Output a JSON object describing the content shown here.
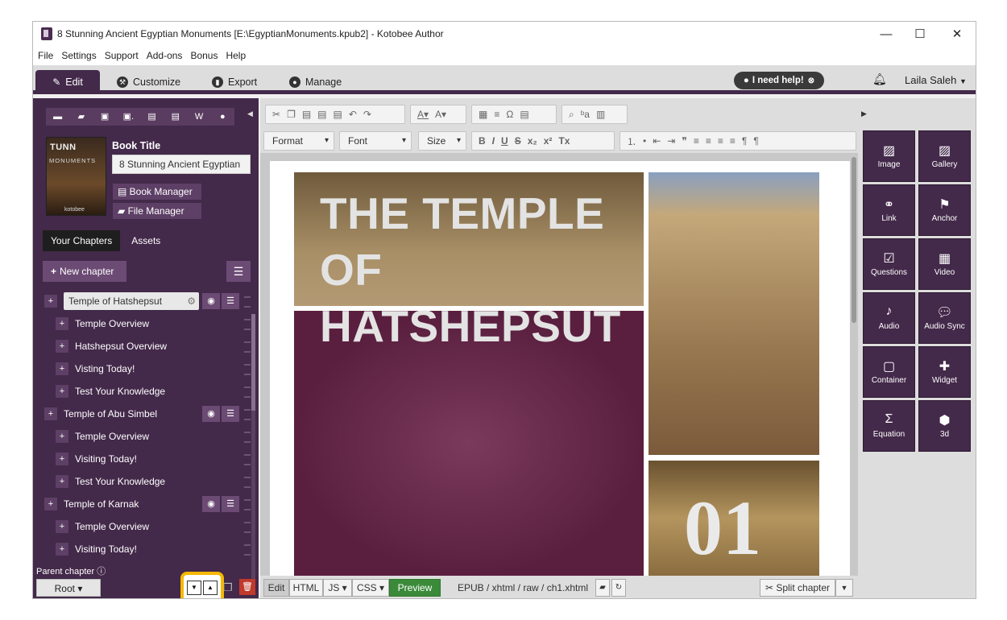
{
  "window": {
    "title": "8 Stunning Ancient Egyptian Monuments [E:\\EgyptianMonuments.kpub2] - Kotobee Author",
    "controls": {
      "minimize": "—",
      "maximize": "☐",
      "close": "✕"
    }
  },
  "menu": [
    "File",
    "Settings",
    "Support",
    "Add-ons",
    "Bonus",
    "Help"
  ],
  "tabs": [
    {
      "label": "Edit",
      "icon": "pencil-icon"
    },
    {
      "label": "Customize",
      "icon": "wrench-icon"
    },
    {
      "label": "Export",
      "icon": "export-icon"
    },
    {
      "label": "Manage",
      "icon": "user-icon"
    }
  ],
  "help_button": "I need help!",
  "user_name": "Laila Saleh",
  "book": {
    "title_label": "Book Title",
    "title_value": "8 Stunning Ancient Egyptian",
    "cover_line1": "TUNN",
    "cover_line2": "MONUMENTS",
    "cover_logo": "kotobee",
    "book_manager": "Book Manager",
    "file_manager": "File Manager"
  },
  "chapter_tabs": {
    "chapters": "Your Chapters",
    "assets": "Assets"
  },
  "new_chapter": "New chapter",
  "chapters": [
    {
      "label": "Temple of Hatshepsut",
      "level": 0,
      "selected": true
    },
    {
      "label": "Temple Overview",
      "level": 1
    },
    {
      "label": "Hatshepsut Overview",
      "level": 1
    },
    {
      "label": "Visting Today!",
      "level": 1
    },
    {
      "label": "Test Your Knowledge",
      "level": 1
    },
    {
      "label": "Temple of Abu Simbel",
      "level": 0
    },
    {
      "label": "Temple Overview",
      "level": 1
    },
    {
      "label": "Visiting Today!",
      "level": 1
    },
    {
      "label": "Test Your Knowledge",
      "level": 1
    },
    {
      "label": "Temple of Karnak",
      "level": 0
    },
    {
      "label": "Temple Overview",
      "level": 1
    },
    {
      "label": "Visiting Today!",
      "level": 1
    }
  ],
  "parent_chapter_label": "Parent chapter",
  "root_button": "Root ▾",
  "toolbar": {
    "format": "Format",
    "font": "Font",
    "size": "Size"
  },
  "page_content": {
    "headline": "THE TEMPLE OF HATSHEPSUT",
    "number": "01"
  },
  "bottom": {
    "edit": "Edit",
    "html": "HTML",
    "js": "JS ▾",
    "css": "CSS ▾",
    "preview": "Preview",
    "path": "EPUB / xhtml / raw / ch1.xhtml",
    "split": "✂ Split chapter"
  },
  "widgets": [
    {
      "label": "Image",
      "icon": "image-icon"
    },
    {
      "label": "Gallery",
      "icon": "gallery-icon"
    },
    {
      "label": "Link",
      "icon": "link-icon"
    },
    {
      "label": "Anchor",
      "icon": "anchor-icon"
    },
    {
      "label": "Questions",
      "icon": "questions-icon"
    },
    {
      "label": "Video",
      "icon": "video-icon"
    },
    {
      "label": "Audio",
      "icon": "audio-icon"
    },
    {
      "label": "Audio Sync",
      "icon": "audio-sync-icon"
    },
    {
      "label": "Container",
      "icon": "container-icon"
    },
    {
      "label": "Widget",
      "icon": "widget-icon"
    },
    {
      "label": "Equation",
      "icon": "equation-icon"
    },
    {
      "label": "3d",
      "icon": "cube-icon"
    }
  ]
}
